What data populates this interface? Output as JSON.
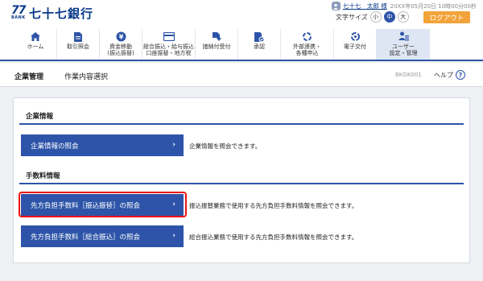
{
  "brand": {
    "mark": "77",
    "mark_sub": "BANK",
    "name": "七十七銀行"
  },
  "user": {
    "icon": "user-badge-icon",
    "name": "七十七　太郎 様",
    "login_time": "20XX年05月20日 10時00分00秒"
  },
  "font_size": {
    "label": "文字サイズ",
    "small": "小",
    "medium": "中",
    "large": "大",
    "selected": "中"
  },
  "logout_label": "ログアウト",
  "nav": [
    {
      "label": "ホーム",
      "icon": "home-icon"
    },
    {
      "label": "取引照会",
      "icon": "document-icon"
    },
    {
      "label": "資金移動\n(振込振替)",
      "icon": "yen-transfer-icon"
    },
    {
      "label": "総合振込・給与振込\n口座振替・地方税",
      "icon": "card-icon"
    },
    {
      "label": "諸納付受付",
      "icon": "payment-icon"
    },
    {
      "label": "承認",
      "icon": "approve-icon"
    },
    {
      "label": "外部連携・\n各種申込",
      "icon": "link-icon"
    },
    {
      "label": "電子交付",
      "icon": "delivery-icon"
    },
    {
      "label": "ユーザー\n設定・管理",
      "icon": "user-settings-icon"
    }
  ],
  "breadcrumb": {
    "main": "企業管理",
    "sub": "作業内容選択"
  },
  "screen_id": "BKGK001",
  "help_label": "ヘルプ",
  "sections": [
    {
      "title": "企業情報",
      "items": [
        {
          "label": "企業情報の照会",
          "desc": "企業情報を照会できます。"
        }
      ]
    },
    {
      "title": "手数料情報",
      "items": [
        {
          "label": "先方負担手数料［振込振替］の照会",
          "desc": "振込振替業務で使用する先方負担手数料情報を照会できます。"
        },
        {
          "label": "先方負担手数料［総合振込］の照会",
          "desc": "総合振込業務で使用する先方負担手数料情報を照会できます。"
        }
      ]
    }
  ],
  "colors": {
    "primary": "#2d54a8",
    "logout": "#f2a33a",
    "highlight": "#e11111",
    "background": "#eef0f4"
  }
}
